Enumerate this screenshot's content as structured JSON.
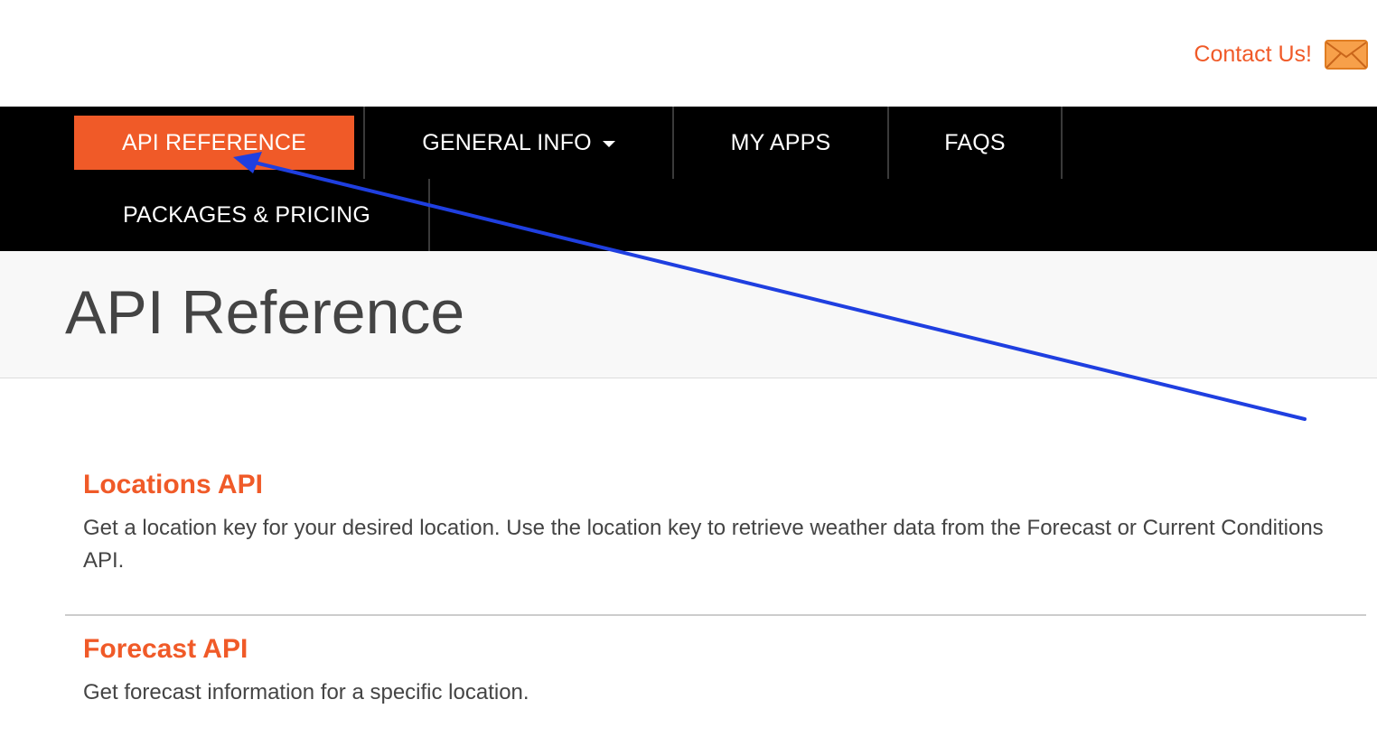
{
  "header": {
    "contact_label": "Contact Us!",
    "contact_icon": "mail-icon"
  },
  "nav": {
    "items": [
      {
        "label": "API REFERENCE",
        "active": true
      },
      {
        "label": "GENERAL INFO",
        "has_dropdown": true
      },
      {
        "label": "MY APPS"
      },
      {
        "label": "FAQS"
      },
      {
        "label": "PACKAGES & PRICING"
      }
    ]
  },
  "page": {
    "title": "API Reference"
  },
  "apis": [
    {
      "title": "Locations API",
      "description": "Get a location key for your desired location. Use the location key to retrieve weather data from the Forecast or Current Conditions API."
    },
    {
      "title": "Forecast API",
      "description": "Get forecast information for a specific location."
    }
  ],
  "colors": {
    "accent": "#f05a28",
    "nav_background": "#000000",
    "hero_background": "#f8f8f8",
    "text": "#444444",
    "annotation_arrow": "#1f3fe0"
  }
}
